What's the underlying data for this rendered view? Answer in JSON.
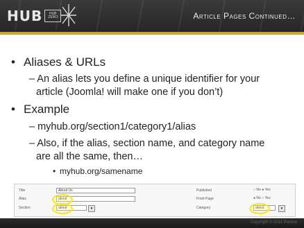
{
  "header": {
    "logo_text": "HUB",
    "logo_box": "HUB ZERO",
    "title": "Article Pages Continued…"
  },
  "bullets": [
    {
      "text": "Aliases & URLs"
    },
    {
      "text": "– An alias lets you define a unique identifier for your"
    },
    {
      "text": "article (Joomla! will make one if you don’t)"
    },
    {
      "text": "Example"
    },
    {
      "text": "– myhub.org/section1/category1/alias"
    },
    {
      "text": "– Also, if the alias, section name, and category name"
    },
    {
      "text": "are all the same, then…"
    },
    {
      "text": "myhub.org/samename"
    }
  ],
  "form": {
    "title_label": "Title",
    "title_value": "About Us",
    "alias_label": "Alias",
    "alias_value": "about",
    "section_label": "Section",
    "section_value": "about",
    "published_label": "Published",
    "published_no": "No",
    "published_yes": "Yes",
    "frontpage_label": "Front Page",
    "frontpage_no": "No",
    "frontpage_yes": "Yes",
    "category_label": "Category",
    "category_value": "about"
  },
  "footer": {
    "copyright": "Copyright © 2011 Purdue"
  }
}
